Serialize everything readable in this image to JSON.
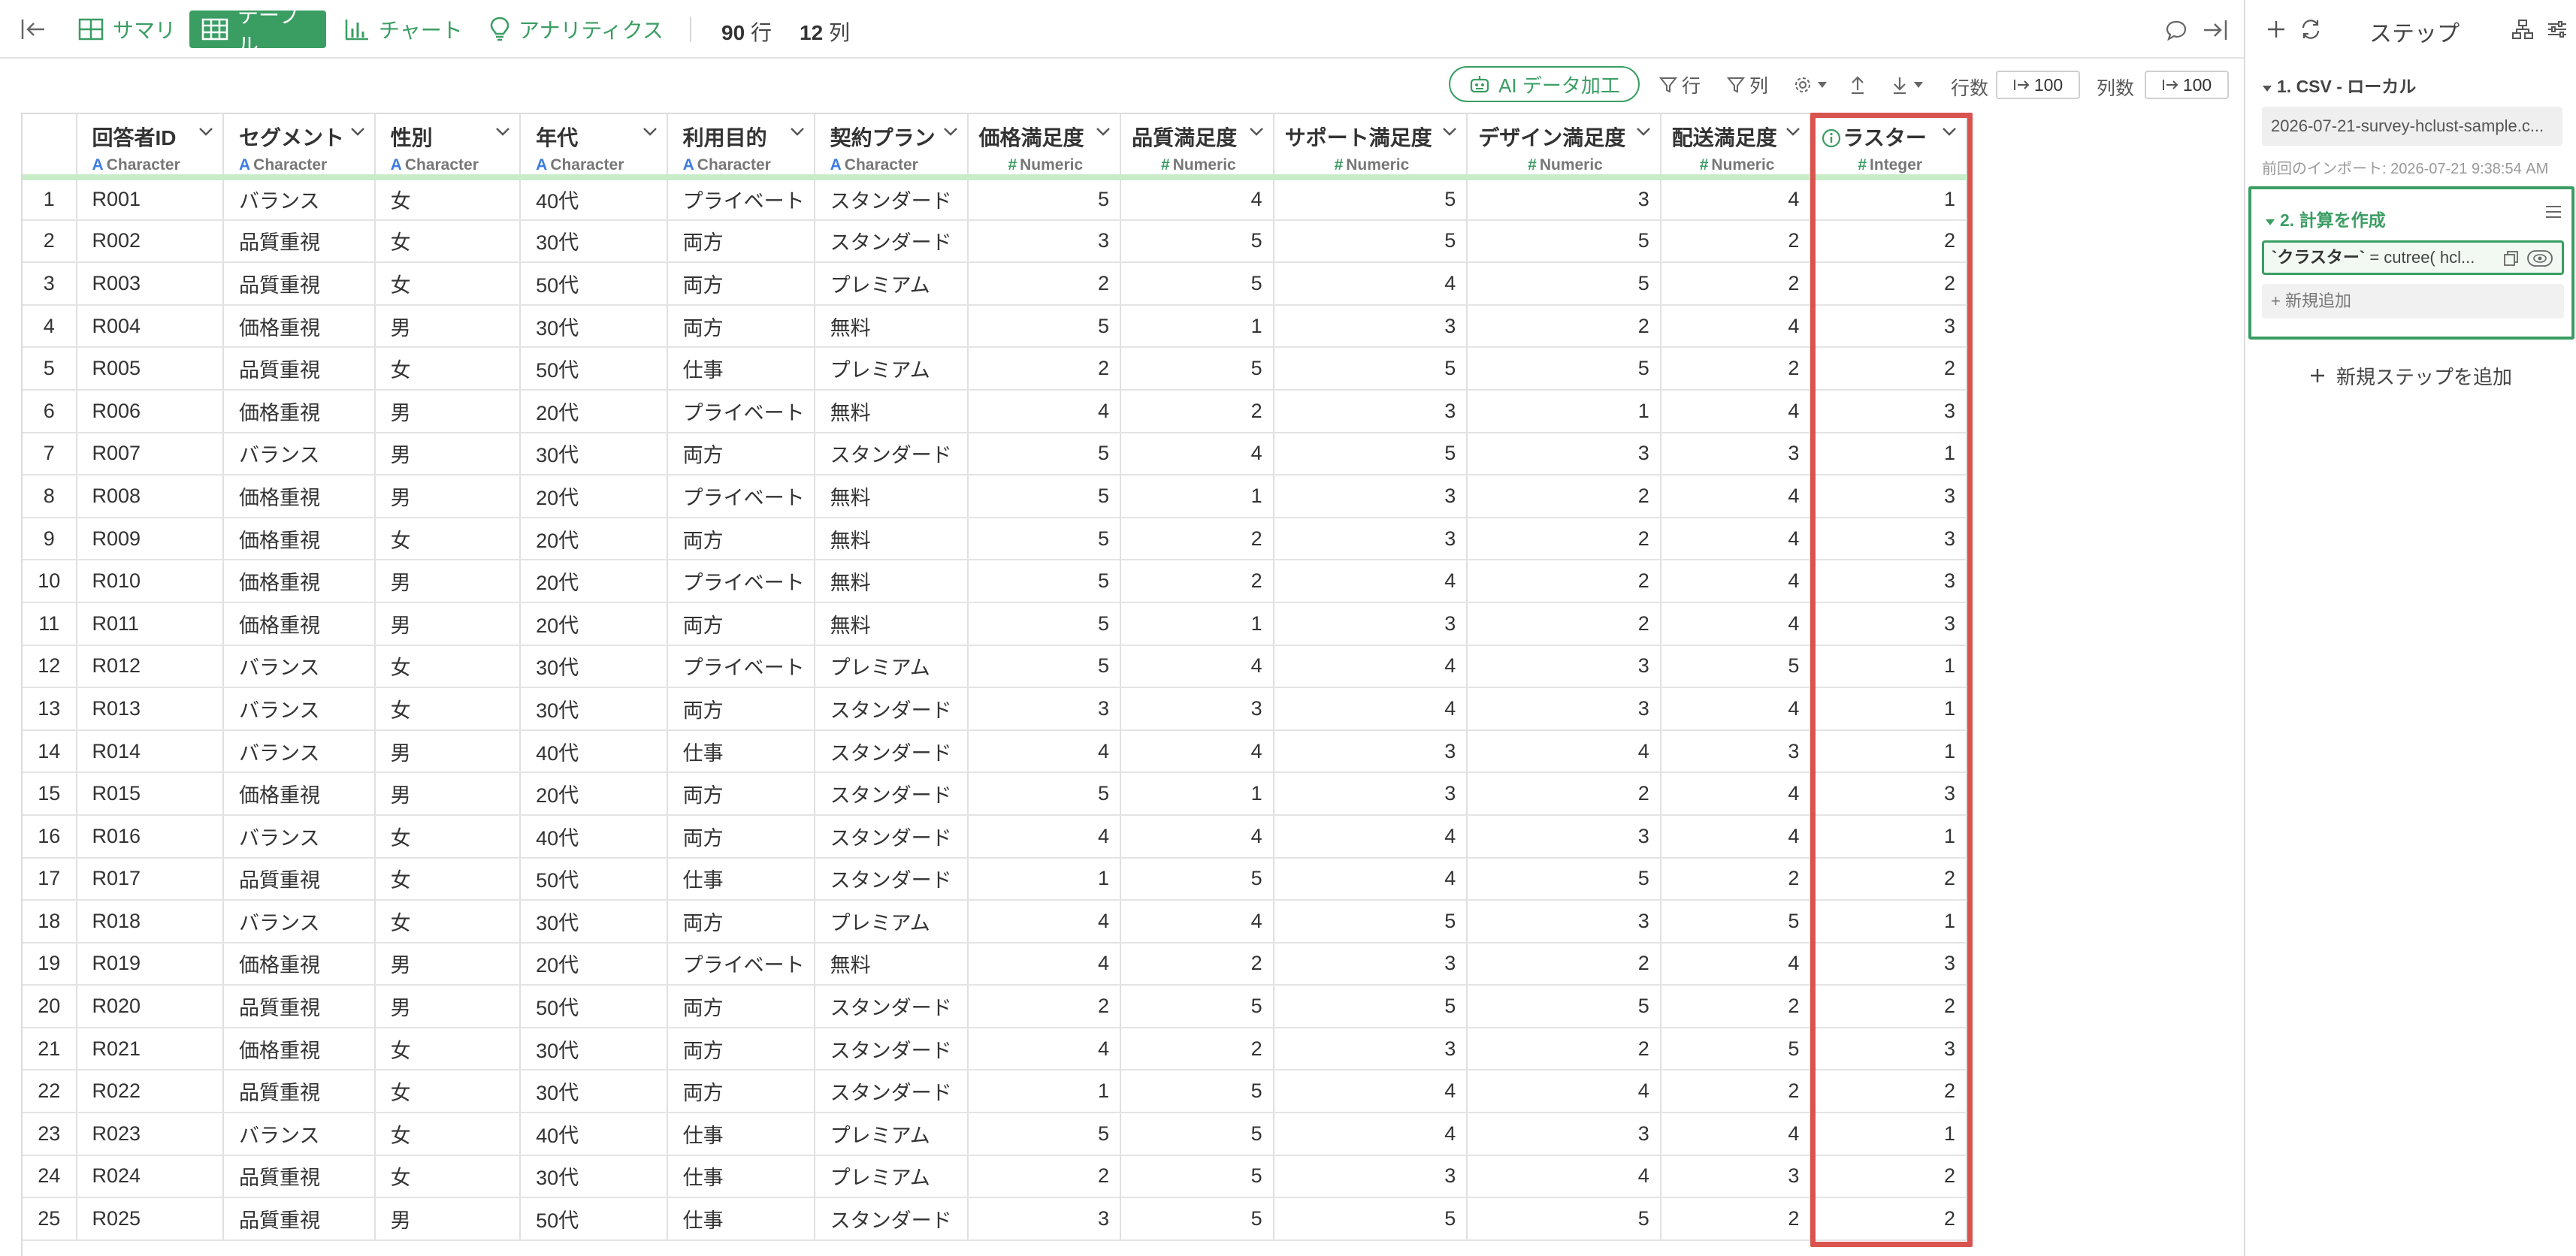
{
  "topbar": {
    "tabs": [
      {
        "label": "サマリ",
        "icon": "summary-grid-icon"
      },
      {
        "label": "テーブル",
        "icon": "table-icon"
      },
      {
        "label": "チャート",
        "icon": "bar-chart-icon"
      },
      {
        "label": "アナリティクス",
        "icon": "lightbulb-icon"
      }
    ],
    "rows_count": "90",
    "rows_unit": "行",
    "cols_count": "12",
    "cols_unit": "列"
  },
  "toolbar": {
    "ai_label": "AI データ加工",
    "row_filter": "行",
    "col_filter": "列",
    "rows_label": "行数",
    "rows_value": "100",
    "cols_label": "列数",
    "cols_value": "100"
  },
  "columns": [
    {
      "name": "回答者ID",
      "type": "Character",
      "kind": "A"
    },
    {
      "name": "セグメント",
      "type": "Character",
      "kind": "A"
    },
    {
      "name": "性別",
      "type": "Character",
      "kind": "A"
    },
    {
      "name": "年代",
      "type": "Character",
      "kind": "A"
    },
    {
      "name": "利用目的",
      "type": "Character",
      "kind": "A"
    },
    {
      "name": "契約プラン",
      "type": "Character",
      "kind": "A"
    },
    {
      "name": "価格満足度",
      "type": "Numeric",
      "kind": "#"
    },
    {
      "name": "品質満足度",
      "type": "Numeric",
      "kind": "#"
    },
    {
      "name": "サポート満足度",
      "type": "Numeric",
      "kind": "#"
    },
    {
      "name": "デザイン満足度",
      "type": "Numeric",
      "kind": "#"
    },
    {
      "name": "配送満足度",
      "type": "Numeric",
      "kind": "#"
    },
    {
      "name": "ラスター",
      "type": "Integer",
      "kind": "#"
    }
  ],
  "rows": [
    [
      "1",
      "R001",
      "バランス",
      "女",
      "40代",
      "プライベート",
      "スタンダード",
      "5",
      "4",
      "5",
      "3",
      "4",
      "1"
    ],
    [
      "2",
      "R002",
      "品質重視",
      "女",
      "30代",
      "両方",
      "スタンダード",
      "3",
      "5",
      "5",
      "5",
      "2",
      "2"
    ],
    [
      "3",
      "R003",
      "品質重視",
      "女",
      "50代",
      "両方",
      "プレミアム",
      "2",
      "5",
      "4",
      "5",
      "2",
      "2"
    ],
    [
      "4",
      "R004",
      "価格重視",
      "男",
      "30代",
      "両方",
      "無料",
      "5",
      "1",
      "3",
      "2",
      "4",
      "3"
    ],
    [
      "5",
      "R005",
      "品質重視",
      "女",
      "50代",
      "仕事",
      "プレミアム",
      "2",
      "5",
      "5",
      "5",
      "2",
      "2"
    ],
    [
      "6",
      "R006",
      "価格重視",
      "男",
      "20代",
      "プライベート",
      "無料",
      "4",
      "2",
      "3",
      "1",
      "4",
      "3"
    ],
    [
      "7",
      "R007",
      "バランス",
      "男",
      "30代",
      "両方",
      "スタンダード",
      "5",
      "4",
      "5",
      "3",
      "3",
      "1"
    ],
    [
      "8",
      "R008",
      "価格重視",
      "男",
      "20代",
      "プライベート",
      "無料",
      "5",
      "1",
      "3",
      "2",
      "4",
      "3"
    ],
    [
      "9",
      "R009",
      "価格重視",
      "女",
      "20代",
      "両方",
      "無料",
      "5",
      "2",
      "3",
      "2",
      "4",
      "3"
    ],
    [
      "10",
      "R010",
      "価格重視",
      "男",
      "20代",
      "プライベート",
      "無料",
      "5",
      "2",
      "4",
      "2",
      "4",
      "3"
    ],
    [
      "11",
      "R011",
      "価格重視",
      "男",
      "20代",
      "両方",
      "無料",
      "5",
      "1",
      "3",
      "2",
      "4",
      "3"
    ],
    [
      "12",
      "R012",
      "バランス",
      "女",
      "30代",
      "プライベート",
      "プレミアム",
      "5",
      "4",
      "4",
      "3",
      "5",
      "1"
    ],
    [
      "13",
      "R013",
      "バランス",
      "女",
      "30代",
      "両方",
      "スタンダード",
      "3",
      "3",
      "4",
      "3",
      "4",
      "1"
    ],
    [
      "14",
      "R014",
      "バランス",
      "男",
      "40代",
      "仕事",
      "スタンダード",
      "4",
      "4",
      "3",
      "4",
      "3",
      "1"
    ],
    [
      "15",
      "R015",
      "価格重視",
      "男",
      "20代",
      "両方",
      "スタンダード",
      "5",
      "1",
      "3",
      "2",
      "4",
      "3"
    ],
    [
      "16",
      "R016",
      "バランス",
      "女",
      "40代",
      "両方",
      "スタンダード",
      "4",
      "4",
      "4",
      "3",
      "4",
      "1"
    ],
    [
      "17",
      "R017",
      "品質重視",
      "女",
      "50代",
      "仕事",
      "スタンダード",
      "1",
      "5",
      "4",
      "5",
      "2",
      "2"
    ],
    [
      "18",
      "R018",
      "バランス",
      "女",
      "30代",
      "両方",
      "プレミアム",
      "4",
      "4",
      "5",
      "3",
      "5",
      "1"
    ],
    [
      "19",
      "R019",
      "価格重視",
      "男",
      "20代",
      "プライベート",
      "無料",
      "4",
      "2",
      "3",
      "2",
      "4",
      "3"
    ],
    [
      "20",
      "R020",
      "品質重視",
      "男",
      "50代",
      "両方",
      "スタンダード",
      "2",
      "5",
      "5",
      "5",
      "2",
      "2"
    ],
    [
      "21",
      "R021",
      "価格重視",
      "女",
      "30代",
      "両方",
      "スタンダード",
      "4",
      "2",
      "3",
      "2",
      "5",
      "3"
    ],
    [
      "22",
      "R022",
      "品質重視",
      "女",
      "30代",
      "両方",
      "スタンダード",
      "1",
      "5",
      "4",
      "4",
      "2",
      "2"
    ],
    [
      "23",
      "R023",
      "バランス",
      "女",
      "40代",
      "仕事",
      "プレミアム",
      "5",
      "5",
      "4",
      "3",
      "4",
      "1"
    ],
    [
      "24",
      "R024",
      "品質重視",
      "女",
      "30代",
      "仕事",
      "プレミアム",
      "2",
      "5",
      "3",
      "4",
      "3",
      "2"
    ],
    [
      "25",
      "R025",
      "品質重視",
      "男",
      "50代",
      "仕事",
      "スタンダード",
      "3",
      "5",
      "5",
      "5",
      "2",
      "2"
    ]
  ],
  "panel": {
    "title": "ステップ",
    "step1_title": "1. CSV - ローカル",
    "step1_file": "2026-07-21-survey-hclust-sample.c...",
    "step1_note": "前回のインポート: 2026-07-21 9:38:54 AM",
    "step2_title": "2. 計算を作成",
    "step2_formula_name": "`クラスター`",
    "step2_formula_rest": " = cutree( hcl...",
    "step2_add": "+ 新規追加",
    "add_step": "新規ステップを追加"
  },
  "colors": {
    "accent": "#3a9d62",
    "highlight": "#d9534f"
  }
}
